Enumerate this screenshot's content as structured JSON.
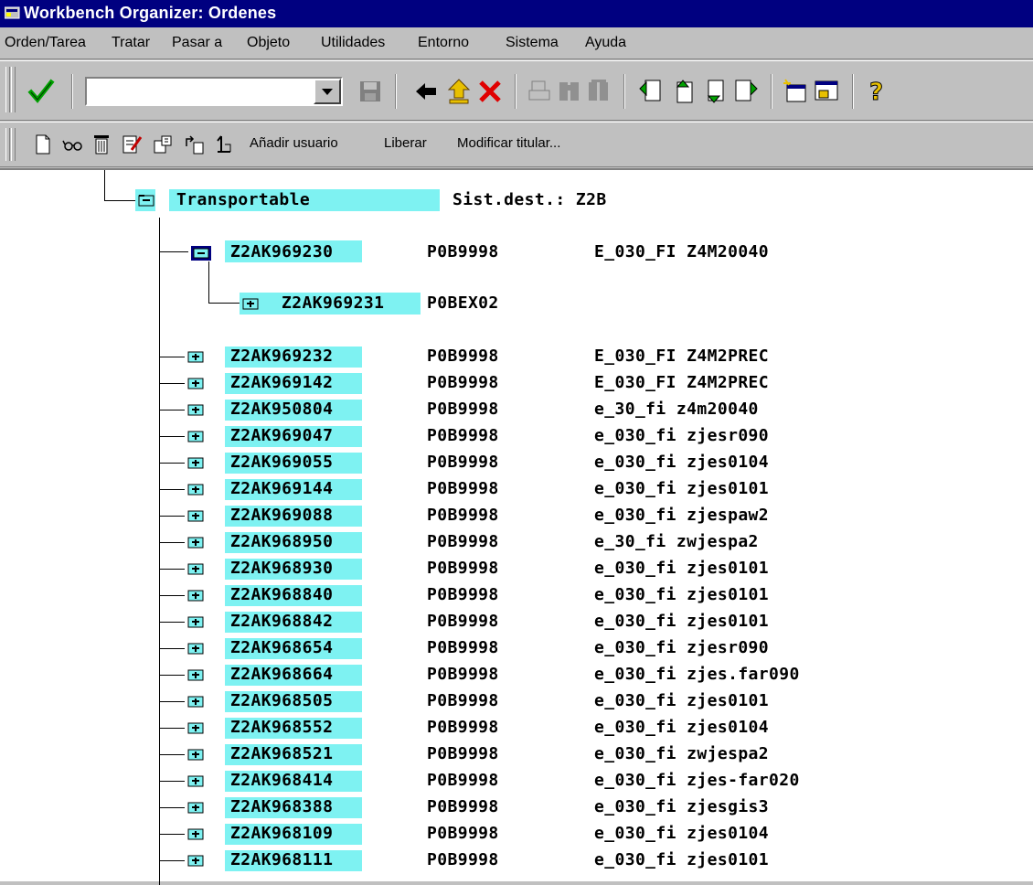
{
  "window": {
    "title": "Workbench Organizer: Ordenes"
  },
  "menu": [
    {
      "label": "Orden/Tarea"
    },
    {
      "label": "Tratar"
    },
    {
      "label": "Pasar a"
    },
    {
      "label": "Objeto"
    },
    {
      "label": "Utilidades"
    },
    {
      "label": "Entorno"
    },
    {
      "label": "Sistema"
    },
    {
      "label": "Ayuda"
    }
  ],
  "toolbar": {
    "command_value": "",
    "icons": [
      "enter-icon",
      "save-icon",
      "back-icon",
      "exit-icon",
      "cancel-icon",
      "print-icon",
      "find-icon",
      "find-next-icon",
      "first-page-icon",
      "previous-page-icon",
      "next-page-icon",
      "last-page-icon",
      "new-session-icon",
      "shortcut-icon",
      "help-icon"
    ]
  },
  "app_toolbar": {
    "icons": [
      "create-icon",
      "display-change-icon",
      "delete-icon",
      "check-icon",
      "release-directly-icon",
      "transfer-icon",
      "protect-icon"
    ],
    "add_user": "Añadir usuario",
    "release": "Liberar",
    "change_owner": "Modificar titular..."
  },
  "tree": {
    "root": {
      "label": "Transportable",
      "target_label": "Sist.dest.: Z2B"
    },
    "expanded": {
      "id": "Z2AK969230",
      "owner": "P0B9998",
      "desc": "E_030_FI Z4M20040",
      "child": {
        "id": "Z2AK969231",
        "owner": "P0BEX02"
      }
    },
    "rows": [
      {
        "id": "Z2AK969232",
        "owner": "P0B9998",
        "desc": "E_030_FI Z4M2PREC"
      },
      {
        "id": "Z2AK969142",
        "owner": "P0B9998",
        "desc": "E_030_FI Z4M2PREC"
      },
      {
        "id": "Z2AK950804",
        "owner": "P0B9998",
        "desc": "e_30_fi z4m20040"
      },
      {
        "id": "Z2AK969047",
        "owner": "P0B9998",
        "desc": "e_030_fi zjesr090"
      },
      {
        "id": "Z2AK969055",
        "owner": "P0B9998",
        "desc": "e_030_fi zjes0104"
      },
      {
        "id": "Z2AK969144",
        "owner": "P0B9998",
        "desc": "e_030_fi zjes0101"
      },
      {
        "id": "Z2AK969088",
        "owner": "P0B9998",
        "desc": "e_030_fi zjespaw2"
      },
      {
        "id": "Z2AK968950",
        "owner": "P0B9998",
        "desc": "e_30_fi zwjespa2"
      },
      {
        "id": "Z2AK968930",
        "owner": "P0B9998",
        "desc": "e_030_fi zjes0101"
      },
      {
        "id": "Z2AK968840",
        "owner": "P0B9998",
        "desc": "e_030_fi zjes0101"
      },
      {
        "id": "Z2AK968842",
        "owner": "P0B9998",
        "desc": "e_030_fi zjes0101"
      },
      {
        "id": "Z2AK968654",
        "owner": "P0B9998",
        "desc": "e_030_fi zjesr090"
      },
      {
        "id": "Z2AK968664",
        "owner": "P0B9998",
        "desc": "e_030_fi zjes.far090"
      },
      {
        "id": "Z2AK968505",
        "owner": "P0B9998",
        "desc": "e_030_fi zjes0101"
      },
      {
        "id": "Z2AK968552",
        "owner": "P0B9998",
        "desc": "e_030_fi zjes0104"
      },
      {
        "id": "Z2AK968521",
        "owner": "P0B9998",
        "desc": "e_030_fi zwjespa2"
      },
      {
        "id": "Z2AK968414",
        "owner": "P0B9998",
        "desc": "e_030_fi zjes-far020"
      },
      {
        "id": "Z2AK968388",
        "owner": "P0B9998",
        "desc": "e_030_fi zjesgis3"
      },
      {
        "id": "Z2AK968109",
        "owner": "P0B9998",
        "desc": "e_030_fi zjes0104"
      },
      {
        "id": "Z2AK968111",
        "owner": "P0B9998",
        "desc": "e_030_fi zjes0101"
      }
    ]
  },
  "colors": {
    "titlebar": "#000080",
    "highlight": "#7ef2f2",
    "selected_node": "#000080"
  }
}
